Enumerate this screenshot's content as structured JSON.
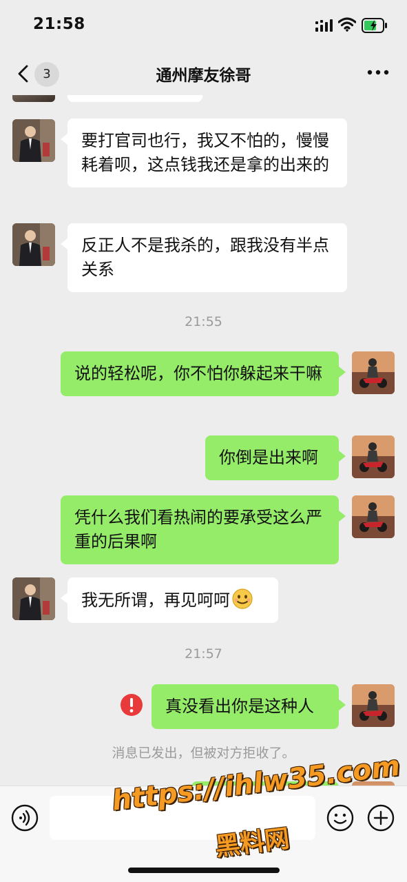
{
  "status_bar": {
    "time": "21:58",
    "battery_color": "#34c759"
  },
  "nav": {
    "unread_count": "3",
    "title": "通州摩友徐哥",
    "back_icon": "chevron-left-icon",
    "more_icon": "more-dots-icon"
  },
  "messages": [
    {
      "side": "in",
      "text": "要打官司也行，我又不怕的，慢慢耗着呗，这点钱我还是拿的出来的"
    },
    {
      "side": "in",
      "text": "反正人不是我杀的，跟我没有半点关系"
    },
    {
      "type": "time",
      "text": "21:55"
    },
    {
      "side": "out",
      "text": "说的轻松呢，你不怕你躲起来干嘛"
    },
    {
      "side": "out",
      "text": "你倒是出来啊"
    },
    {
      "side": "out",
      "text": "凭什么我们看热闹的要承受这么严重的后果啊"
    },
    {
      "side": "in",
      "text": "我无所谓，再见呵呵",
      "emoji": "awkward-smile-emoji"
    },
    {
      "type": "time",
      "text": "21:57"
    },
    {
      "side": "out",
      "text": "真没看出你是这种人",
      "status": "failed"
    },
    {
      "type": "system",
      "text": "消息已发出，但被对方拒收了。"
    }
  ],
  "input_bar": {
    "placeholder": "",
    "voice_icon": "voice-icon",
    "emoji_icon": "emoji-icon",
    "plus_icon": "plus-icon"
  },
  "watermark": {
    "line1": "https://ihlw35.com",
    "line2": "黑料网"
  },
  "colors": {
    "background": "#ededed",
    "bubble_out": "#95ec69",
    "bubble_in": "#ffffff",
    "error": "#e83a3a",
    "watermark": "#f59a23"
  }
}
